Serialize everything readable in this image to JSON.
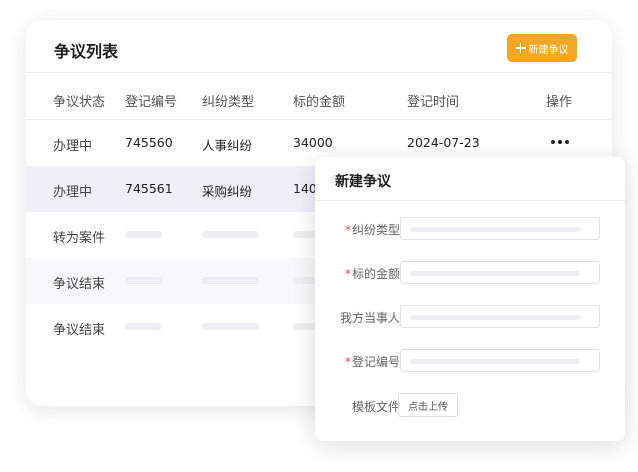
{
  "list": {
    "title": "争议列表",
    "new_button_label": "新建争议",
    "columns": [
      "争议状态",
      "登记编号",
      "纠纷类型",
      "标的金额",
      "登记时间",
      "操作"
    ],
    "rows": [
      {
        "status": "办理中",
        "id": "745560",
        "type": "人事纠纷",
        "amount": "34000",
        "time": "2024-07-23"
      },
      {
        "status": "办理中",
        "id": "745561",
        "type": "采购纠纷",
        "amount": "140"
      },
      {
        "status": "转为案件"
      },
      {
        "status": "争议结束"
      },
      {
        "status": "争议结束"
      }
    ]
  },
  "dialog": {
    "title": "新建争议",
    "fields": [
      {
        "label": "纠纷类型",
        "required_mark": "*"
      },
      {
        "label": "标的金额",
        "required_mark": "*"
      },
      {
        "label": "我方当事人",
        "required_mark": ""
      },
      {
        "label": "登记编号",
        "required_mark": "*"
      }
    ],
    "template_label": "模板文件",
    "upload_button_label": "点击上传"
  },
  "colors": {
    "accent": "#f5a623",
    "required": "#e5484d",
    "highlight_row": "#eef0f8"
  },
  "icons": {
    "new_button": "plus-icon",
    "row_action": "more-icon"
  }
}
